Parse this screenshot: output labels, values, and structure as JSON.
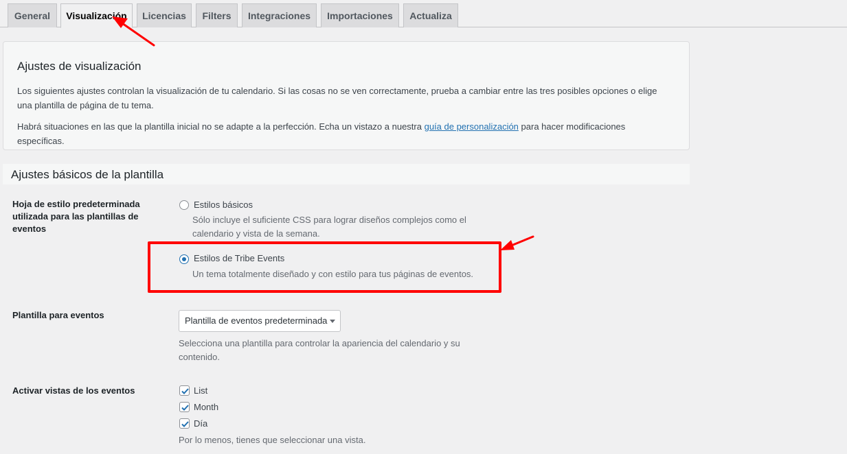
{
  "tabs": [
    {
      "label": "General"
    },
    {
      "label": "Visualización",
      "active": true
    },
    {
      "label": "Licencias"
    },
    {
      "label": "Filters"
    },
    {
      "label": "Integraciones"
    },
    {
      "label": "Importaciones"
    },
    {
      "label": "Actualiza"
    }
  ],
  "info": {
    "title": "Ajustes de visualización",
    "p1": "Los siguientes ajustes controlan la visualización de tu calendario. Si las cosas no se ven correctamente, prueba a cambiar entre las tres posibles opciones o elige una plantilla de página de tu tema.",
    "p2_before": "Habrá situaciones en las que la plantilla inicial no se adapte a la perfección. Echa un vistazo a nuestra ",
    "p2_link": "guía de personalización",
    "p2_after": " para hacer modificaciones específicas."
  },
  "section": {
    "title": "Ajustes básicos de la plantilla"
  },
  "stylesheet": {
    "label": "Hoja de estilo predeterminada utilizada para las plantillas de eventos",
    "options": [
      {
        "title": "Estilos básicos",
        "desc": "Sólo incluye el suficiente CSS para lograr diseños complejos como el calendario y vista de la semana.",
        "checked": false
      },
      {
        "title": "Estilos de Tribe Events",
        "desc": "Un tema totalmente diseñado y con estilo para tus páginas de eventos.",
        "checked": true
      }
    ]
  },
  "template": {
    "label": "Plantilla para eventos",
    "selected": "Plantilla de eventos predeterminada",
    "help": "Selecciona una plantilla para controlar la apariencia del calendario y su contenido."
  },
  "views": {
    "label": "Activar vistas de los eventos",
    "items": [
      {
        "label": "List",
        "checked": true
      },
      {
        "label": "Month",
        "checked": true
      },
      {
        "label": "Día",
        "checked": true
      }
    ],
    "help": "Por lo menos, tienes que seleccionar una vista."
  },
  "colors": {
    "highlight": "#ff0000",
    "accent": "#2271b1"
  }
}
